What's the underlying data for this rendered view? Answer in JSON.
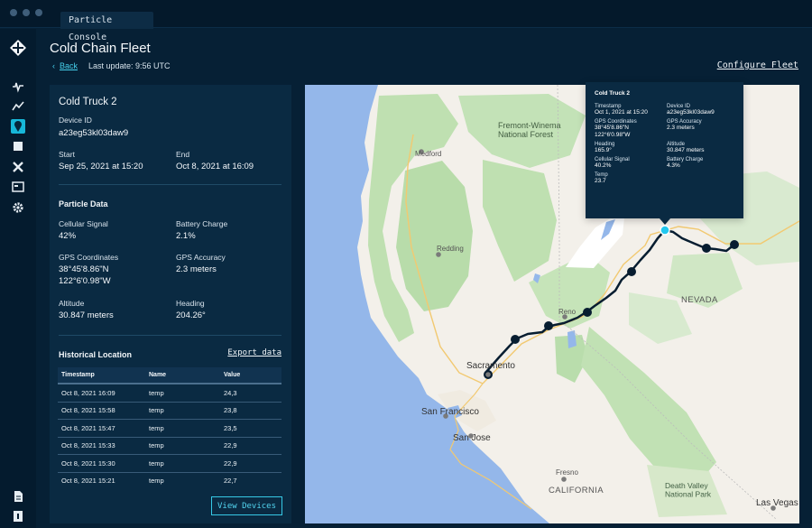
{
  "app": {
    "tab_title": "Particle Console"
  },
  "header": {
    "title": "Cold Chain Fleet",
    "back_label": "Back",
    "last_update": "Last update: 9:56 UTC",
    "configure_label": "Configure Fleet"
  },
  "rail_icons": [
    "particle-logo",
    "sparkline-icon",
    "pulse-icon",
    "map-pin-icon",
    "square-icon",
    "tools-icon",
    "terminal-icon",
    "settings-icon",
    "document-icon",
    "info-icon"
  ],
  "panel": {
    "device_name": "Cold Truck 2",
    "device_id_label": "Device ID",
    "device_id": "a23eg53kl03daw9",
    "start_label": "Start",
    "start_value": "Sep 25, 2021 at 15:20",
    "end_label": "End",
    "end_value": "Oct 8, 2021 at 16:09",
    "particle_data_title": "Particle Data",
    "cellular_label": "Cellular Signal",
    "cellular_value": "42%",
    "battery_label": "Battery Charge",
    "battery_value": "2.1%",
    "gps_label": "GPS Coordinates",
    "gps_value": "38°45'8.86\"N\n122°6'0.98\"W",
    "accuracy_label": "GPS Accuracy",
    "accuracy_value": "2.3 meters",
    "altitude_label": "Altitude",
    "altitude_value": "30.847 meters",
    "heading_label": "Heading",
    "heading_value": "204.26°",
    "historical_title": "Historical Location",
    "export_label": "Export data",
    "view_devices_label": "View Devices"
  },
  "table": {
    "columns": [
      "Timestamp",
      "Name",
      "Value"
    ],
    "rows": [
      [
        "Oct 8, 2021 16:09",
        "temp",
        "24,3"
      ],
      [
        "Oct 8, 2021 15:58",
        "temp",
        "23,8"
      ],
      [
        "Oct 8, 2021 15:47",
        "temp",
        "23,5"
      ],
      [
        "Oct 8, 2021 15:33",
        "temp",
        "22,9"
      ],
      [
        "Oct 8, 2021 15:30",
        "temp",
        "22,9"
      ],
      [
        "Oct 8, 2021 15:21",
        "temp",
        "22,7"
      ]
    ]
  },
  "map": {
    "labels": [
      "Fremont-Winema\nNational Forest",
      "Medford",
      "Redding",
      "Reno",
      "NEVADA",
      "Sacramento",
      "San Francisco",
      "San Jose",
      "Fresno",
      "CALIFORNIA",
      "Death Valley\nNational Park",
      "Las Vegas"
    ],
    "colors": {
      "water": "#94b7ea",
      "land": "#f3f0ea",
      "park": "#c7e3ba",
      "route": "#071d30",
      "active_marker": "#22c8ef",
      "highway": "#f2c971"
    }
  },
  "popup": {
    "title": "Cold Truck 2",
    "fields": [
      {
        "label": "Timestamp",
        "value": "Oct 1, 2021 at 15:20"
      },
      {
        "label": "Device ID",
        "value": "a23eg53kl03daw9"
      },
      {
        "label": "GPS Coordinates",
        "value": "38°45'8.86\"N\n122°6'0.98\"W"
      },
      {
        "label": "GPS Accuracy",
        "value": "2.3 meters"
      },
      {
        "label": "Heading",
        "value": "165.9°"
      },
      {
        "label": "Altitude",
        "value": "30.847 meters"
      },
      {
        "label": "Cellular Signal",
        "value": "40.2%"
      },
      {
        "label": "Battery Charge",
        "value": "4.3%"
      },
      {
        "label": "Temp",
        "value": "23.7"
      }
    ]
  }
}
